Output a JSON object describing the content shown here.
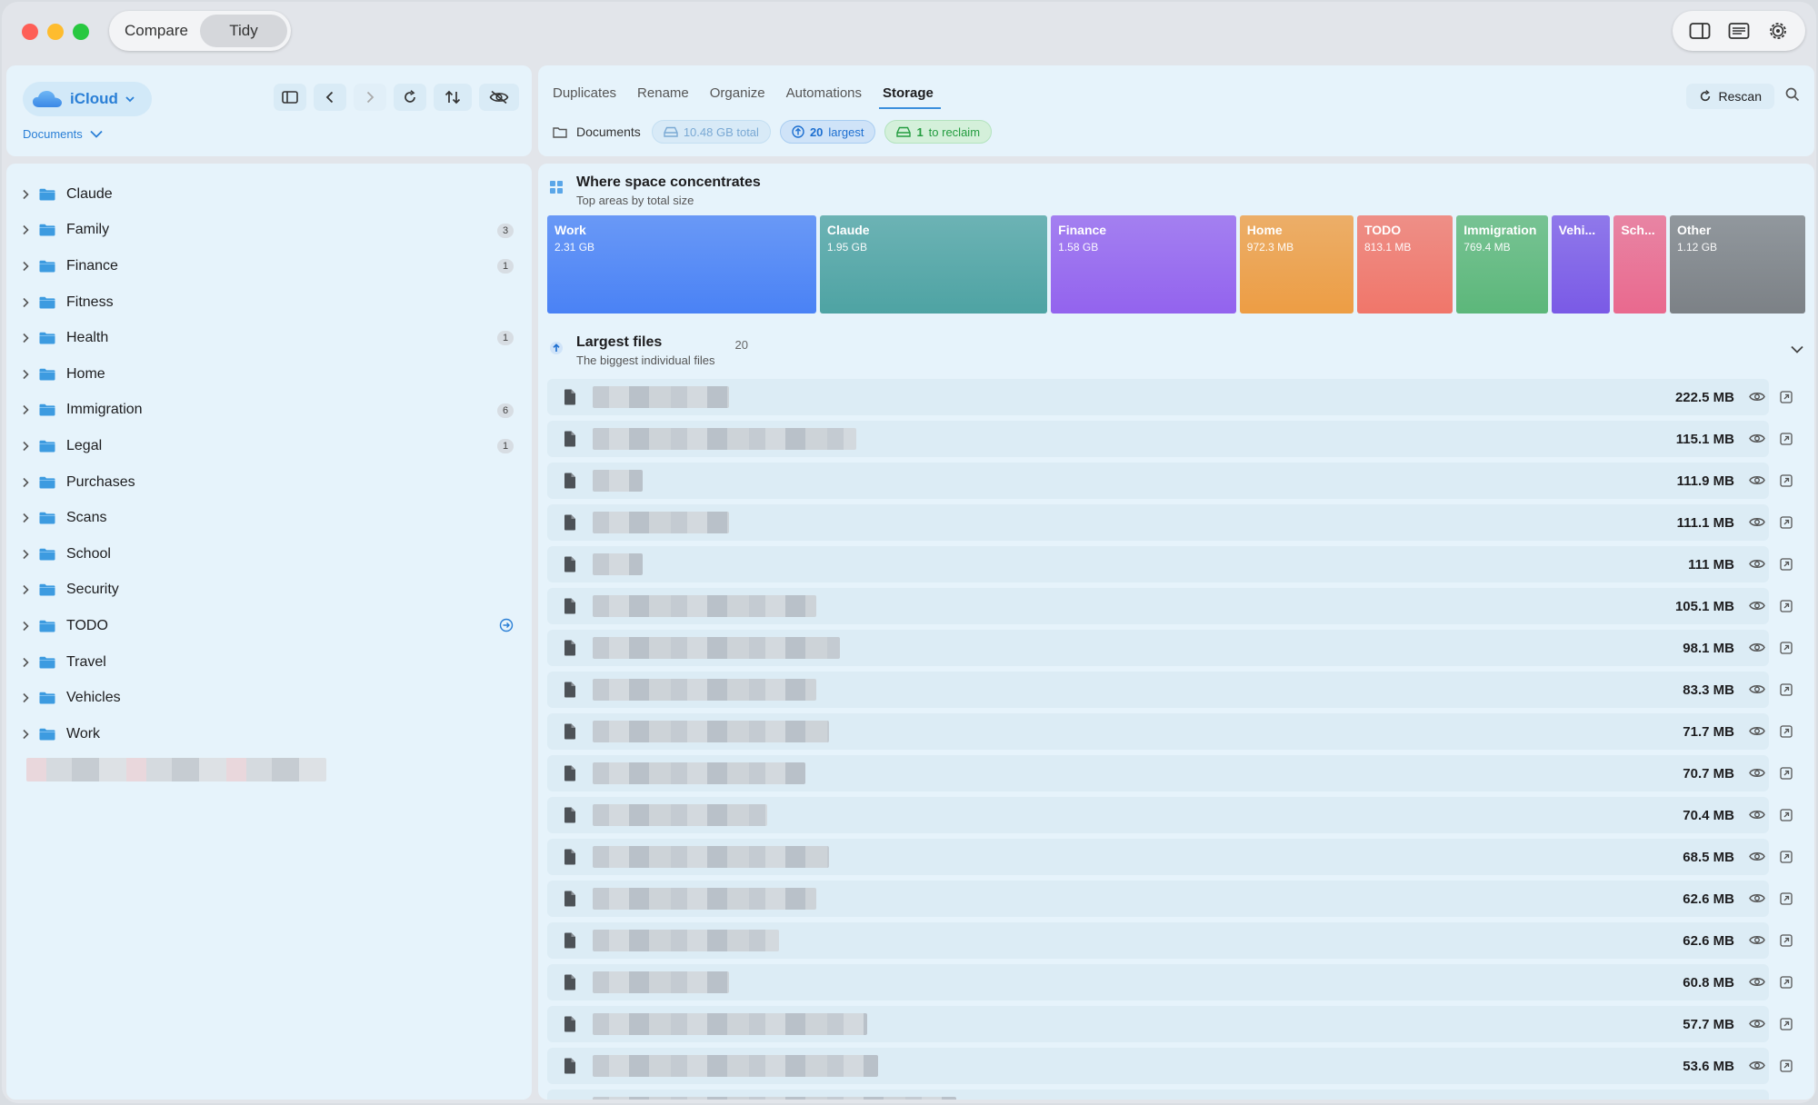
{
  "segmented": {
    "compare": "Compare",
    "tidy": "Tidy"
  },
  "location": {
    "source": "iCloud",
    "breadcrumb": "Documents"
  },
  "folders": [
    {
      "name": "Claude",
      "count": ""
    },
    {
      "name": "Family",
      "count": "3"
    },
    {
      "name": "Finance",
      "count": "1"
    },
    {
      "name": "Fitness",
      "count": ""
    },
    {
      "name": "Health",
      "count": "1"
    },
    {
      "name": "Home",
      "count": ""
    },
    {
      "name": "Immigration",
      "count": "6"
    },
    {
      "name": "Legal",
      "count": "1"
    },
    {
      "name": "Purchases",
      "count": ""
    },
    {
      "name": "Scans",
      "count": ""
    },
    {
      "name": "School",
      "count": ""
    },
    {
      "name": "Security",
      "count": ""
    },
    {
      "name": "TODO",
      "count": "",
      "arrow": true
    },
    {
      "name": "Travel",
      "count": ""
    },
    {
      "name": "Vehicles",
      "count": ""
    },
    {
      "name": "Work",
      "count": ""
    }
  ],
  "tabs": [
    "Duplicates",
    "Rename",
    "Organize",
    "Automations",
    "Storage"
  ],
  "active_tab": "Storage",
  "toolbar": {
    "rescan": "Rescan"
  },
  "summary": {
    "folder": "Documents",
    "total": "10.48 GB total",
    "largest_num": "20",
    "largest_label": "largest",
    "reclaim_num": "1",
    "reclaim_label": "to reclaim"
  },
  "treemap": {
    "title": "Where space concentrates",
    "subtitle": "Top areas by total size",
    "tiles": [
      {
        "name": "Work",
        "size": "2.31 GB",
        "color": "#4a82f5"
      },
      {
        "name": "Claude",
        "size": "1.95 GB",
        "color": "#4ea3a3"
      },
      {
        "name": "Finance",
        "size": "1.58 GB",
        "color": "#9363ee"
      },
      {
        "name": "Home",
        "size": "972.3 MB",
        "color": "#ed9d44"
      },
      {
        "name": "TODO",
        "size": "813.1 MB",
        "color": "#f0766a"
      },
      {
        "name": "Immigration",
        "size": "769.4 MB",
        "color": "#5cb77a"
      },
      {
        "name": "Vehi...",
        "size": "",
        "color": "#7a5ae6"
      },
      {
        "name": "Sch...",
        "size": "",
        "color": "#e9698e"
      },
      {
        "name": "Other",
        "size": "1.12 GB",
        "color": "#7c8186"
      }
    ]
  },
  "largest_files": {
    "title": "Largest files",
    "subtitle": "The biggest individual files",
    "count": "20",
    "files": [
      {
        "size": "222.5 MB"
      },
      {
        "size": "115.1 MB"
      },
      {
        "size": "111.9 MB"
      },
      {
        "size": "111.1 MB"
      },
      {
        "size": "111 MB"
      },
      {
        "size": "105.1 MB"
      },
      {
        "size": "98.1 MB"
      },
      {
        "size": "83.3 MB"
      },
      {
        "size": "71.7 MB"
      },
      {
        "size": "70.7 MB"
      },
      {
        "size": "70.4 MB"
      },
      {
        "size": "68.5 MB"
      },
      {
        "size": "62.6 MB"
      },
      {
        "size": "62.6 MB"
      },
      {
        "size": "60.8 MB"
      },
      {
        "size": "57.7 MB"
      },
      {
        "size": "53.6 MB"
      },
      {
        "size": ""
      }
    ]
  },
  "colors": {
    "accent": "#2a7fd6",
    "panel": "#e6f3fb",
    "folder": "#3d9be0"
  }
}
